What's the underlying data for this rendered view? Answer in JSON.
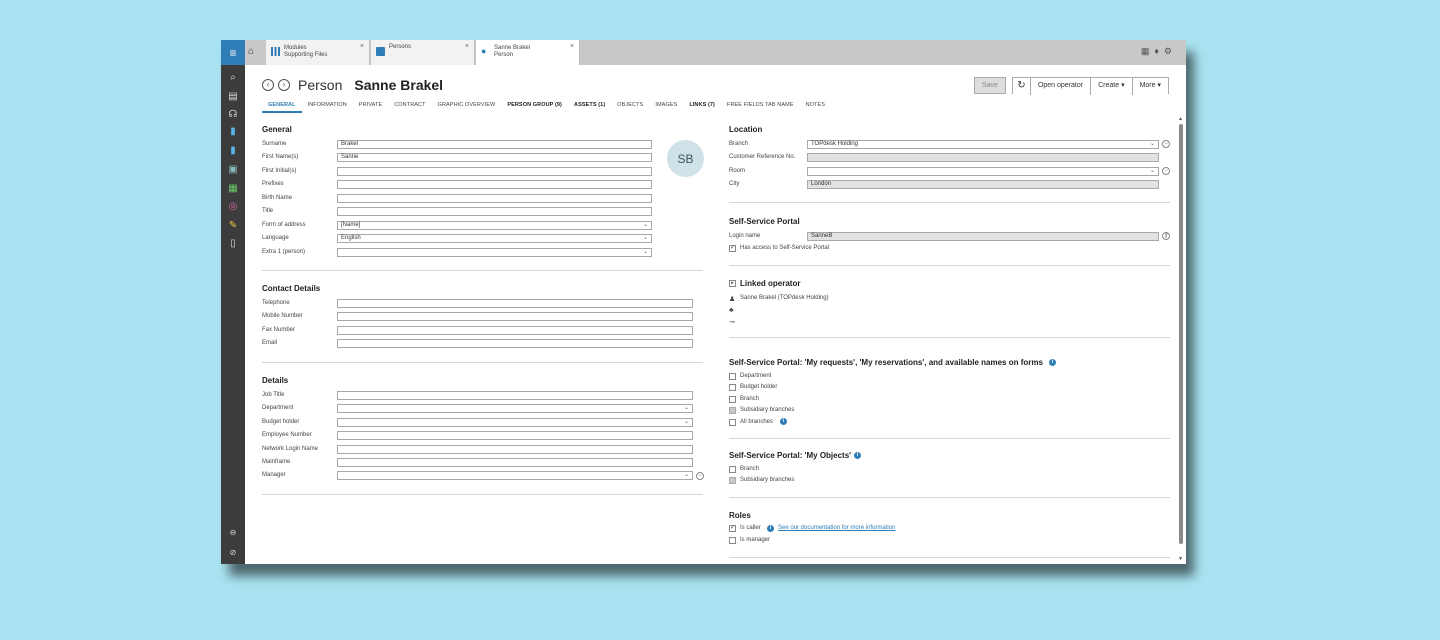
{
  "tabs": [
    {
      "title": "Modules",
      "subtitle": "Supporting Files"
    },
    {
      "title": "Persons",
      "subtitle": ""
    },
    {
      "title": "Sanne Brakel",
      "subtitle": "Person"
    }
  ],
  "header": {
    "type": "Person",
    "name": "Sanne Brakel"
  },
  "toolbar": {
    "save": "Save",
    "open_operator": "Open operator",
    "create": "Create ▾",
    "more": "More ▾"
  },
  "subtabs": [
    "GENERAL",
    "INFORMATION",
    "PRIVATE",
    "CONTRACT",
    "GRAPHIC OVERVIEW",
    "PERSON GROUP (9)",
    "ASSETS (1)",
    "OBJECTS",
    "IMAGES",
    "LINKS (7)",
    "FREE FIELDS TAB NAME",
    "NOTES"
  ],
  "general": {
    "title": "General",
    "avatar": "SB",
    "fields": [
      {
        "label": "Surname",
        "value": "Brakel"
      },
      {
        "label": "First Name(s)",
        "value": "Sanne"
      },
      {
        "label": "First Initial(s)",
        "value": ""
      },
      {
        "label": "Prefixes",
        "value": ""
      },
      {
        "label": "Birth Name",
        "value": ""
      },
      {
        "label": "Title",
        "value": ""
      },
      {
        "label": "Form of address",
        "value": "[Name]"
      },
      {
        "label": "Language",
        "value": "English"
      },
      {
        "label": "Extra 1 (person)",
        "value": ""
      }
    ]
  },
  "contact": {
    "title": "Contact Details",
    "fields": [
      {
        "label": "Telephone",
        "value": ""
      },
      {
        "label": "Mobile Number",
        "value": ""
      },
      {
        "label": "Fax Number",
        "value": ""
      },
      {
        "label": "Email",
        "value": ""
      }
    ]
  },
  "details": {
    "title": "Details",
    "fields": [
      {
        "label": "Job Title",
        "value": ""
      },
      {
        "label": "Department",
        "value": ""
      },
      {
        "label": "Budget holder",
        "value": ""
      },
      {
        "label": "Employee Number",
        "value": ""
      },
      {
        "label": "Network Login Name",
        "value": ""
      },
      {
        "label": "Mainframe",
        "value": ""
      },
      {
        "label": "Manager",
        "value": ""
      }
    ]
  },
  "location": {
    "title": "Location",
    "fields": [
      {
        "label": "Branch",
        "value": "TOPdesk Holding"
      },
      {
        "label": "Customer Reference No.",
        "value": ""
      },
      {
        "label": "Room",
        "value": ""
      },
      {
        "label": "City",
        "value": "London"
      }
    ]
  },
  "ssp": {
    "title": "Self-Service Portal",
    "login_label": "Login name",
    "login_value": "SanneB",
    "access_label": "Has access to Self-Service Portal"
  },
  "linked": {
    "title": "Linked operator",
    "operator": "Sanne Brakel (TOPdesk Holding)"
  },
  "ssp_requests": {
    "title": "Self-Service Portal: 'My requests', 'My reservations', and available names on forms",
    "options": [
      "Department",
      "Budget holder",
      "Branch",
      "Subsidiary branches",
      "All branches"
    ]
  },
  "ssp_objects": {
    "title": "Self-Service Portal: 'My Objects'",
    "options": [
      "Branch",
      "Subsidiary branches"
    ]
  },
  "roles": {
    "title": "Roles",
    "caller": "Is caller",
    "doc_link": "See our documentation for more information",
    "manager": "Is manager"
  }
}
